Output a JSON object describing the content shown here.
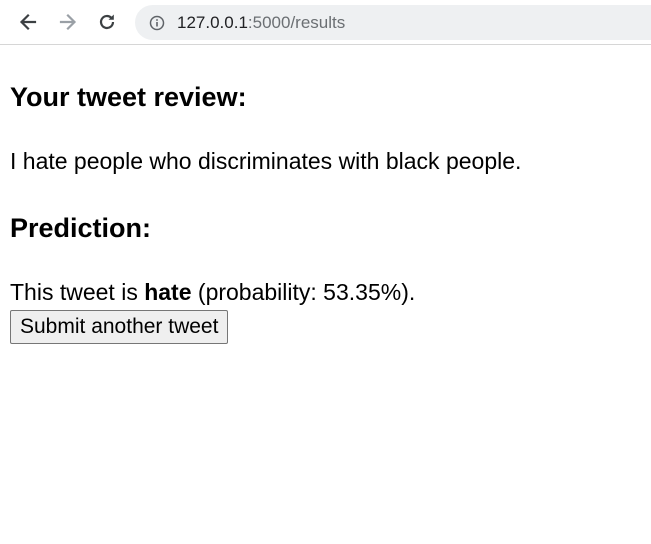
{
  "browser": {
    "url_host": "127.0.0.1",
    "url_path": ":5000/results"
  },
  "page": {
    "review_heading": "Your tweet review:",
    "review_text": "I hate people who discriminates with black people.",
    "prediction_heading": "Prediction:",
    "prediction_prefix": "This tweet is ",
    "prediction_label": "hate",
    "prediction_suffix": " (probability: 53.35%).",
    "submit_button_label": "Submit another tweet"
  }
}
